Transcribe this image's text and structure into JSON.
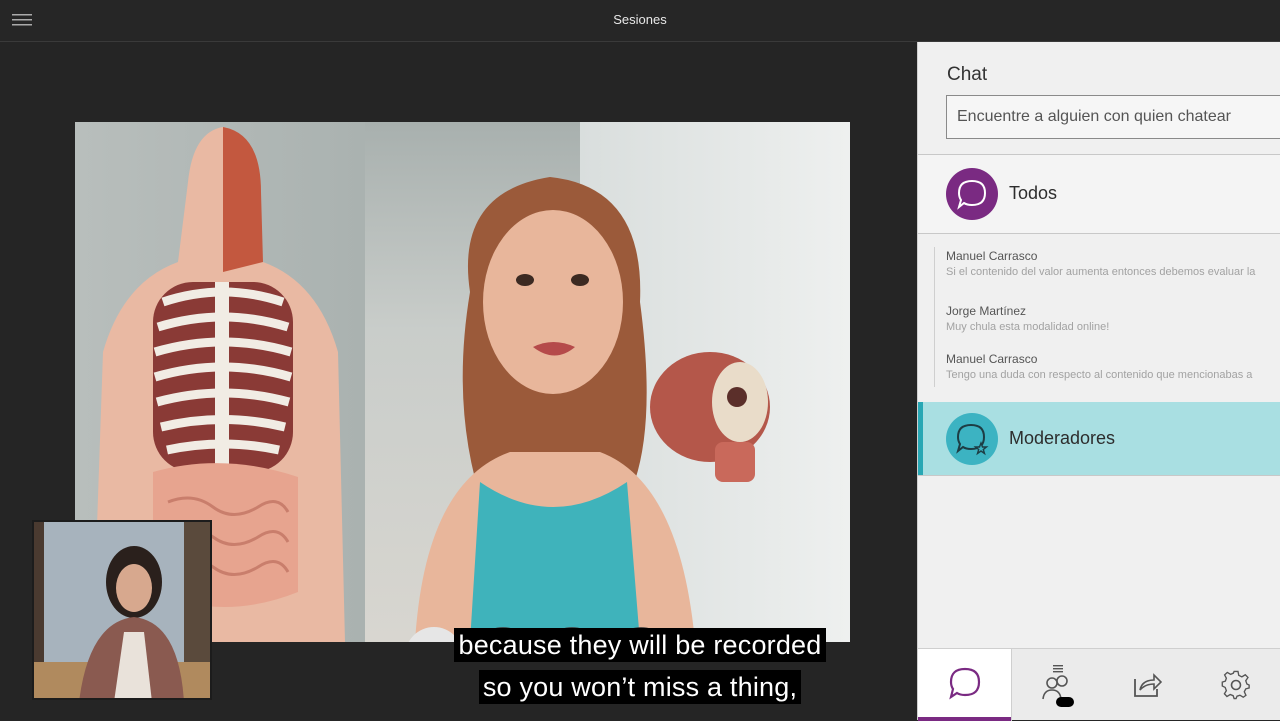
{
  "header": {
    "title": "Sesiones"
  },
  "chat": {
    "title": "Chat",
    "search_placeholder": "Encuentre a alguien con quien chatear",
    "channels": [
      {
        "label": "Todos"
      },
      {
        "label": "Moderadores"
      }
    ],
    "messages": [
      {
        "author": "Manuel Carrasco",
        "text": "Si el contenido del valor aumenta entonces debemos evaluar la"
      },
      {
        "author": "Jorge Martínez",
        "text": "Muy chula esta modalidad online!"
      },
      {
        "author": "Manuel Carrasco",
        "text": "Tengo una duda con respecto al contenido que mencionabas a"
      }
    ]
  },
  "captions": {
    "line1": "because they will be recorded",
    "line2": "so you won’t miss a thing,"
  },
  "colors": {
    "accent_purple": "#7a2a82",
    "moderators_teal": "#3cb3c2",
    "status_green": "#3cb44b"
  },
  "icons": {
    "menu": "hamburger-icon",
    "avatar": "user-avatar-icon",
    "mic": "microphone-muted-icon",
    "camera": "camera-off-icon",
    "hand": "raise-hand-icon",
    "chat_tab": "chat-bubble-icon",
    "participants_tab": "participants-icon",
    "share_tab": "share-icon",
    "settings_tab": "gear-icon"
  }
}
